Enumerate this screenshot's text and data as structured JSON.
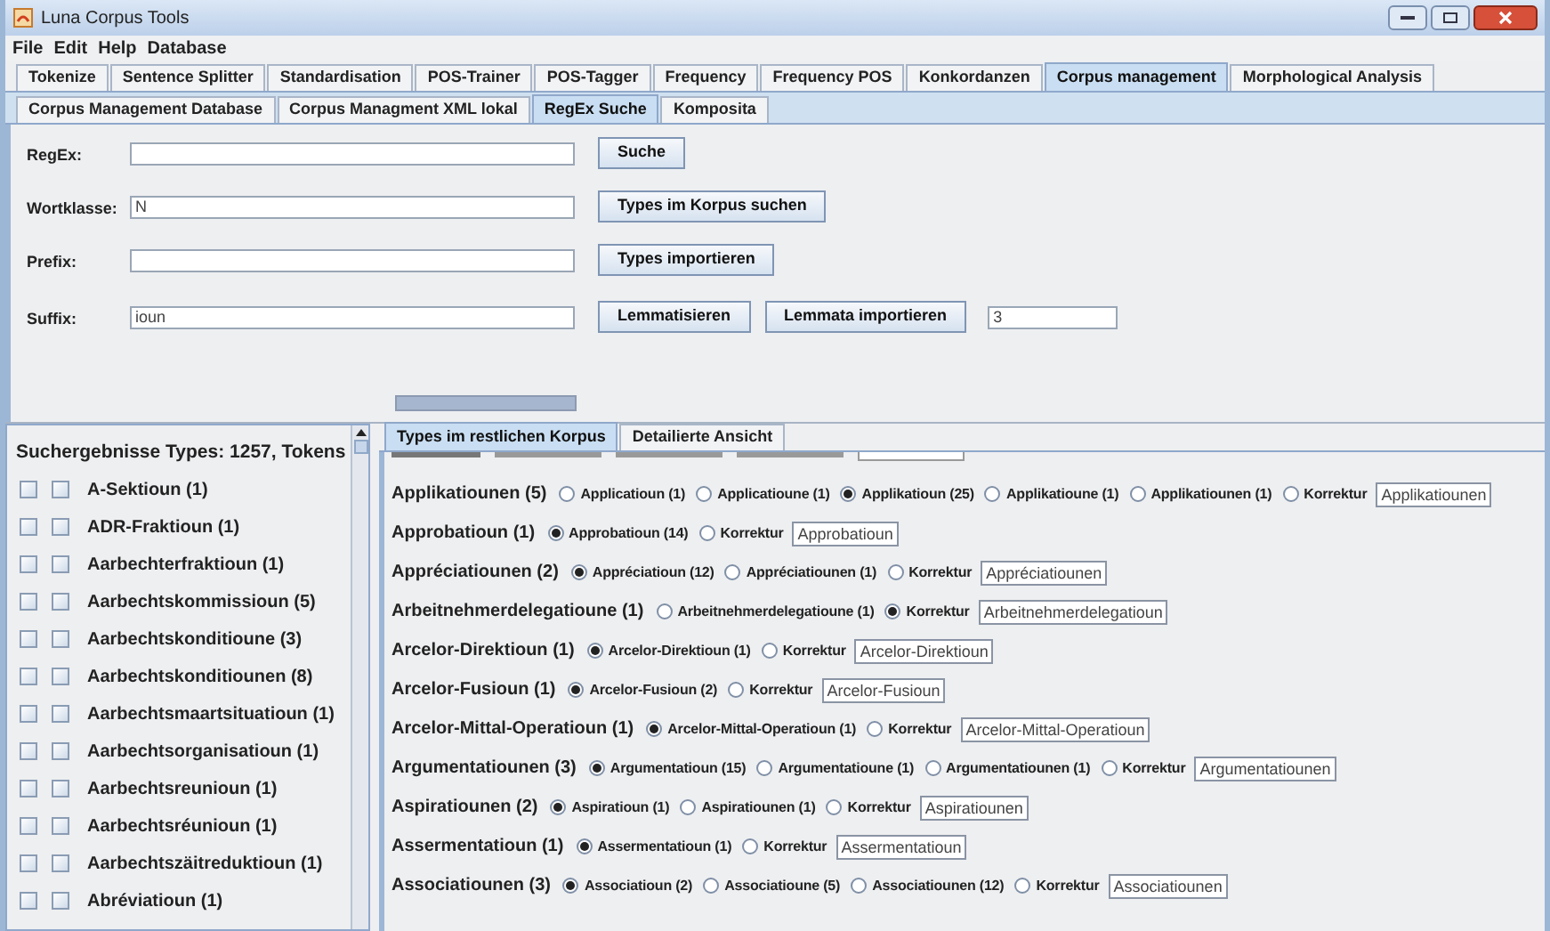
{
  "window": {
    "title": "Luna Corpus Tools"
  },
  "menu": [
    "File",
    "Edit",
    "Help",
    "Database"
  ],
  "tabs": [
    {
      "label": "Tokenize",
      "selected": false
    },
    {
      "label": "Sentence Splitter",
      "selected": false
    },
    {
      "label": "Standardisation",
      "selected": false
    },
    {
      "label": "POS-Trainer",
      "selected": false
    },
    {
      "label": "POS-Tagger",
      "selected": false
    },
    {
      "label": "Frequency",
      "selected": false
    },
    {
      "label": "Frequency POS",
      "selected": false
    },
    {
      "label": "Konkordanzen",
      "selected": false
    },
    {
      "label": "Corpus management",
      "selected": true
    },
    {
      "label": "Morphological Analysis",
      "selected": false
    }
  ],
  "subtabs": [
    {
      "label": "Corpus Management Database",
      "selected": false
    },
    {
      "label": "Corpus Managment XML lokal",
      "selected": false
    },
    {
      "label": "RegEx Suche",
      "selected": true
    },
    {
      "label": "Komposita",
      "selected": false
    }
  ],
  "form": [
    {
      "label": "RegEx:",
      "buttons": [
        "Suche"
      ]
    },
    {
      "label": "Wortklasse:",
      "value": "N",
      "buttons": [
        "Types im Korpus suchen"
      ]
    },
    {
      "label": "Prefix:",
      "buttons": [
        "Types importieren"
      ]
    },
    {
      "label": "Suffix:",
      "value": "ioun",
      "buttons": [
        "Lemmatisieren",
        "Lemmata importieren"
      ],
      "extra_value": "3"
    }
  ],
  "progress": {
    "level": 1
  },
  "results": {
    "header": "Suchergebnisse Types: 1257, Tokens",
    "items": [
      {
        "label": "A-Sektioun (1)",
        "checked_a": false,
        "checked_b": false
      },
      {
        "label": "ADR-Fraktioun (1)",
        "checked_a": false,
        "checked_b": false
      },
      {
        "label": "Aarbechterfraktioun (1)",
        "checked_a": false,
        "checked_b": false
      },
      {
        "label": "Aarbechtskommissioun (5)",
        "checked_a": false,
        "checked_b": false
      },
      {
        "label": "Aarbechtskonditioune (3)",
        "checked_a": false,
        "checked_b": false
      },
      {
        "label": "Aarbechtskonditiounen (8)",
        "checked_a": false,
        "checked_b": false
      },
      {
        "label": "Aarbechtsmaartsituatioun (1)",
        "checked_a": false,
        "checked_b": false
      },
      {
        "label": "Aarbechtsorganisatioun (1)",
        "checked_a": false,
        "checked_b": false
      },
      {
        "label": "Aarbechtsreunioun (1)",
        "checked_a": false,
        "checked_b": false
      },
      {
        "label": "Aarbechtsréunioun (1)",
        "checked_a": false,
        "checked_b": false
      },
      {
        "label": "Aarbechtszäitreduktioun (1)",
        "checked_a": false,
        "checked_b": false
      },
      {
        "label": "Abréviatioun (1)",
        "checked_a": false,
        "checked_b": false
      }
    ]
  },
  "result_tabs": [
    {
      "label": "Types im restlichen Korpus",
      "selected": true
    },
    {
      "label": "Detailierte Ansicht",
      "selected": false
    }
  ],
  "entries": [
    {
      "word": "Applikatiounen (5)",
      "options": [
        {
          "label": "Applicatioun (1)",
          "selected": false
        },
        {
          "label": "Applicatioune (1)",
          "selected": false
        },
        {
          "label": "Applikatioun (25)",
          "selected": true
        },
        {
          "label": "Applikatioune (1)",
          "selected": false
        },
        {
          "label": "Applikatiounen (1)",
          "selected": false
        },
        {
          "label": "Korrektur",
          "selected": false
        }
      ],
      "correction": "Applikatiounen"
    },
    {
      "word": "Approbatioun (1)",
      "options": [
        {
          "label": "Approbatioun (14)",
          "selected": true
        },
        {
          "label": "Korrektur",
          "selected": false
        }
      ],
      "correction": "Approbatioun"
    },
    {
      "word": "Appréciatiounen (2)",
      "options": [
        {
          "label": "Appréciatioun (12)",
          "selected": true
        },
        {
          "label": "Appréciatiounen (1)",
          "selected": false
        },
        {
          "label": "Korrektur",
          "selected": false
        }
      ],
      "correction": "Appréciatiounen"
    },
    {
      "word": "Arbeitnehmerdelegatioune (1)",
      "options": [
        {
          "label": "Arbeitnehmerdelegatioune (1)",
          "selected": false
        },
        {
          "label": "Korrektur",
          "selected": true
        }
      ],
      "correction": "Arbeitnehmerdelegatioun"
    },
    {
      "word": "Arcelor-Direktioun (1)",
      "options": [
        {
          "label": "Arcelor-Direktioun (1)",
          "selected": true
        },
        {
          "label": "Korrektur",
          "selected": false
        }
      ],
      "correction": "Arcelor-Direktioun"
    },
    {
      "word": "Arcelor-Fusioun (1)",
      "options": [
        {
          "label": "Arcelor-Fusioun (2)",
          "selected": true
        },
        {
          "label": "Korrektur",
          "selected": false
        }
      ],
      "correction": "Arcelor-Fusioun"
    },
    {
      "word": "Arcelor-Mittal-Operatioun (1)",
      "options": [
        {
          "label": "Arcelor-Mittal-Operatioun (1)",
          "selected": true
        },
        {
          "label": "Korrektur",
          "selected": false
        }
      ],
      "correction": "Arcelor-Mittal-Operatioun"
    },
    {
      "word": "Argumentatiounen (3)",
      "options": [
        {
          "label": "Argumentatioun (15)",
          "selected": true
        },
        {
          "label": "Argumentatioune (1)",
          "selected": false
        },
        {
          "label": "Argumentatiounen (1)",
          "selected": false
        },
        {
          "label": "Korrektur",
          "selected": false
        }
      ],
      "correction": "Argumentatiounen"
    },
    {
      "word": "Aspiratiounen (2)",
      "options": [
        {
          "label": "Aspiratioun (1)",
          "selected": true
        },
        {
          "label": "Aspiratiounen (1)",
          "selected": false
        },
        {
          "label": "Korrektur",
          "selected": false
        }
      ],
      "correction": "Aspiratiounen"
    },
    {
      "word": "Assermentatioun (1)",
      "options": [
        {
          "label": "Assermentatioun (1)",
          "selected": true
        },
        {
          "label": "Korrektur",
          "selected": false
        }
      ],
      "correction": "Assermentatioun"
    },
    {
      "word": "Associatiounen (3)",
      "options": [
        {
          "label": "Associatioun (2)",
          "selected": true
        },
        {
          "label": "Associatioune (5)",
          "selected": false
        },
        {
          "label": "Associatiounen (12)",
          "selected": false
        },
        {
          "label": "Korrektur",
          "selected": false
        }
      ],
      "correction": "Associatiounen"
    }
  ]
}
